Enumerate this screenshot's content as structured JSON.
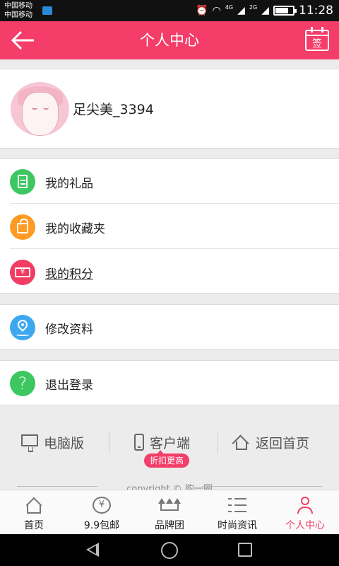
{
  "status_bar": {
    "carrier_1": "中国移动",
    "carrier_2": "中国移动",
    "network_1": "4G",
    "network_2": "2G",
    "time": "11:28",
    "battery_level": 0.75,
    "icons": [
      "sim-icon",
      "alarm-icon",
      "wifi-icon",
      "signal-icon",
      "battery-icon"
    ]
  },
  "header": {
    "title": "个人中心",
    "back_icon": "arrow-left-icon",
    "checkin_label": "签",
    "background": "#f43d69"
  },
  "profile": {
    "username": "足尖美_3394",
    "avatar_icon": "girl-avatar"
  },
  "menu": {
    "gifts": {
      "label": "我的礼品",
      "icon": "document-icon",
      "color": "#3dc760"
    },
    "favorites": {
      "label": "我的收藏夹",
      "icon": "bag-icon",
      "color": "#ff9b22"
    },
    "points": {
      "label": "我的积分",
      "icon": "ticket-icon",
      "color": "#f23c63"
    },
    "profile_edit": {
      "label": "修改资料",
      "icon": "location-pin-icon",
      "color": "#3da8f0"
    },
    "logout": {
      "label": "退出登录",
      "icon": "question-icon",
      "color": "#3dc760"
    }
  },
  "footer_links": {
    "pc_version": "电脑版",
    "client_app": "客户端",
    "discount_badge": "折扣更高",
    "back_home": "返回首页"
  },
  "copyright": "copyright © 购一圈",
  "tabs": [
    {
      "label": "首页",
      "icon": "home-icon",
      "active": false
    },
    {
      "label": "9.9包邮",
      "icon": "yen-coin-icon",
      "active": false
    },
    {
      "label": "品牌团",
      "icon": "crown-icon",
      "active": false
    },
    {
      "label": "时尚资讯",
      "icon": "list-icon",
      "active": false
    },
    {
      "label": "个人中心",
      "icon": "user-icon",
      "active": true
    }
  ],
  "accent_color": "#f43d69"
}
